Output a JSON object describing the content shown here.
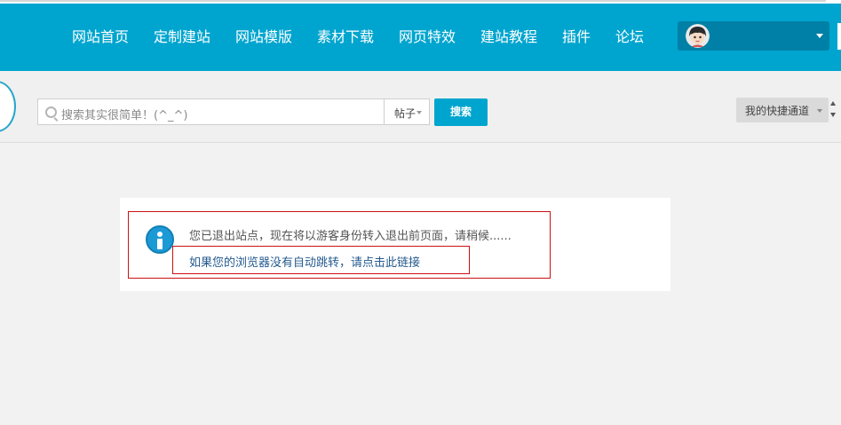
{
  "nav": {
    "items": [
      {
        "label": "网站首页"
      },
      {
        "label": "定制建站"
      },
      {
        "label": "网站模版"
      },
      {
        "label": "素材下载"
      },
      {
        "label": "网页特效"
      },
      {
        "label": "建站教程"
      },
      {
        "label": "插件"
      },
      {
        "label": "论坛"
      }
    ]
  },
  "user": {
    "avatar_icon": "user-avatar-icon"
  },
  "search": {
    "placeholder": "搜索其实很简单！(^_^)",
    "type_label": "帖子",
    "button_label": "搜索"
  },
  "quick": {
    "label": "我的快捷通道"
  },
  "message": {
    "text": "您已退出站点，现在将以游客身份转入退出前页面，请稍候......",
    "link": "如果您的浏览器没有自动跳转，请点击此链接"
  },
  "colors": {
    "brand": "#00a5cf",
    "user_box": "#0080a6",
    "link": "#245a8f",
    "highlight": "#cc1111"
  }
}
